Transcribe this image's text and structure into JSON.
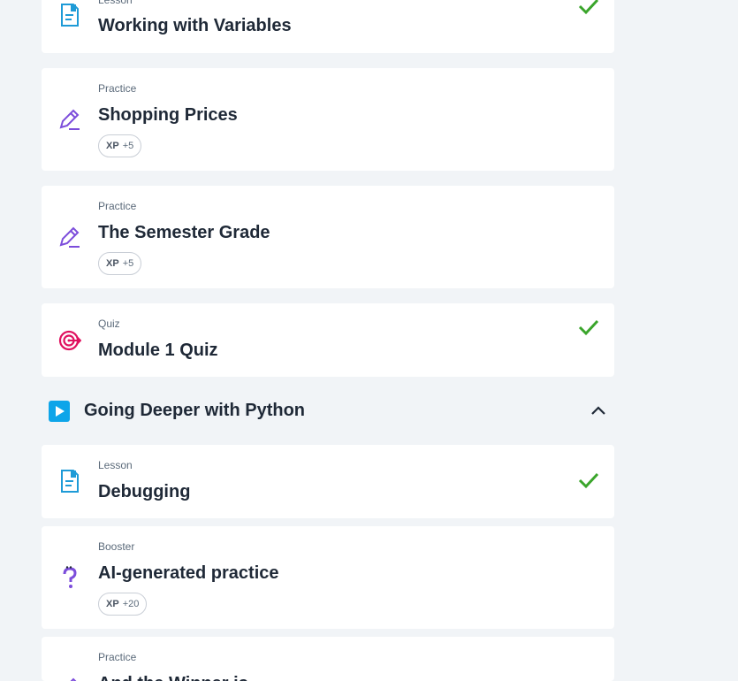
{
  "items": [
    {
      "kind": "Lesson",
      "title": "Working with Variables",
      "done": true
    },
    {
      "kind": "Practice",
      "title": "Shopping Prices",
      "xp_label": "XP",
      "xp_value": "+5"
    },
    {
      "kind": "Practice",
      "title": "The Semester Grade",
      "xp_label": "XP",
      "xp_value": "+5"
    },
    {
      "kind": "Quiz",
      "title": "Module 1 Quiz",
      "done": true
    },
    {
      "kind": "Lesson",
      "title": "Debugging",
      "done": true
    },
    {
      "kind": "Booster",
      "title": "AI-generated practice",
      "xp_label": "XP",
      "xp_value": "+20"
    },
    {
      "kind": "Practice",
      "title": "And the Winner is..."
    }
  ],
  "section": {
    "title": "Going Deeper with Python",
    "expanded": true
  },
  "colors": {
    "lesson": "#1e9bd7",
    "practice": "#7c4ddb",
    "quiz": "#e0115f",
    "check": "#3aa52b",
    "booster": "#7c4ddb"
  }
}
